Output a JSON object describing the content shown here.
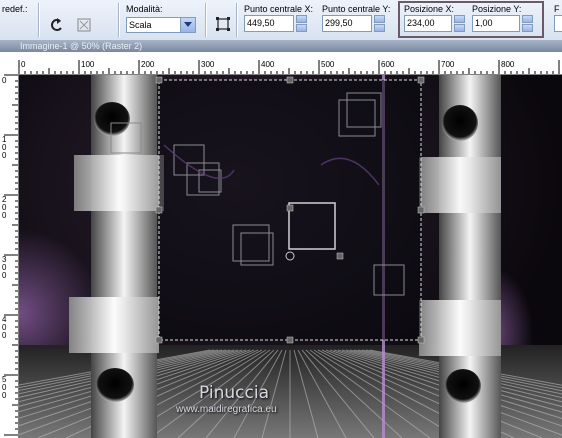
{
  "toolbar": {
    "preset_label": "redef.:",
    "mode_label": "Modalità:",
    "mode_value": "Scala",
    "center_x_label": "Punto centrale X:",
    "center_x_value": "449,50",
    "center_y_label": "Punto centrale Y:",
    "center_y_value": "299,50",
    "pos_x_label": "Posizione X:",
    "pos_x_value": "234,00",
    "pos_y_label": "Posizione Y:",
    "pos_y_value": "1,00",
    "trailing_label": "F"
  },
  "window": {
    "title": "Immagine-1 @ 50% (Raster 2)"
  },
  "rulers": {
    "horizontal_ticks": [
      "0",
      "100",
      "200",
      "300",
      "400",
      "500",
      "600",
      "700",
      "800"
    ],
    "vertical_ticks": [
      "0",
      "100",
      "200",
      "300",
      "400",
      "500"
    ]
  },
  "canvas": {
    "watermark_name": "Pinuccia",
    "watermark_url": "www.maidiregrafica.eu"
  },
  "colors": {
    "toolbar_bg": "#dde6f3",
    "canvas_bg": "#0b080d",
    "accent_purple": "#8a5ea0",
    "highlight_border": "#6b5a65"
  }
}
